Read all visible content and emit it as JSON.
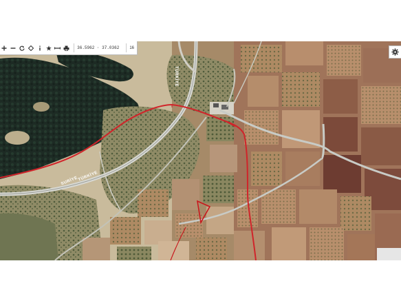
{
  "toolbar": {
    "buttons": [
      {
        "name": "zoom-in-icon",
        "glyph": "plus"
      },
      {
        "name": "zoom-out-icon",
        "glyph": "minus"
      },
      {
        "name": "refresh-icon",
        "glyph": "refresh"
      },
      {
        "name": "center-icon",
        "glyph": "diamond"
      },
      {
        "name": "info-icon",
        "glyph": "info"
      },
      {
        "name": "favorite-star-icon",
        "glyph": "star"
      },
      {
        "name": "measure-icon",
        "glyph": "measure"
      },
      {
        "name": "print-icon",
        "glyph": "print"
      }
    ],
    "coordinates": "36.5962 · 37.0362",
    "zoom_level": "16"
  },
  "settings": {
    "icon": "gear-icon"
  },
  "map": {
    "road_labels": [
      "TÜRKİYE",
      "SURİYE",
      "TÜRKİYE"
    ],
    "colors": {
      "boundary": "#d0242a",
      "parcel": "#c8171c",
      "road": "#d7d9d5",
      "forest": "#1b2a22",
      "field": "#b48a63"
    }
  }
}
